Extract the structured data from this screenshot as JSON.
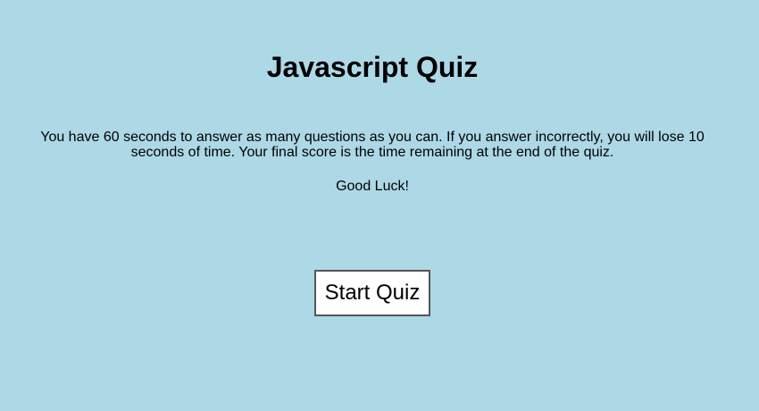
{
  "quiz": {
    "title": "Javascript Quiz",
    "instructions": "You have 60 seconds to answer as many questions as you can. If you answer incorrectly, you will lose 10 seconds of time. Your final score is the time remaining at the end of the quiz.",
    "good_luck": "Good Luck!",
    "start_label": "Start Quiz"
  },
  "colors": {
    "background": "#add8e6",
    "button_background": "#ffffff",
    "button_border": "#555555",
    "text": "#000000"
  }
}
